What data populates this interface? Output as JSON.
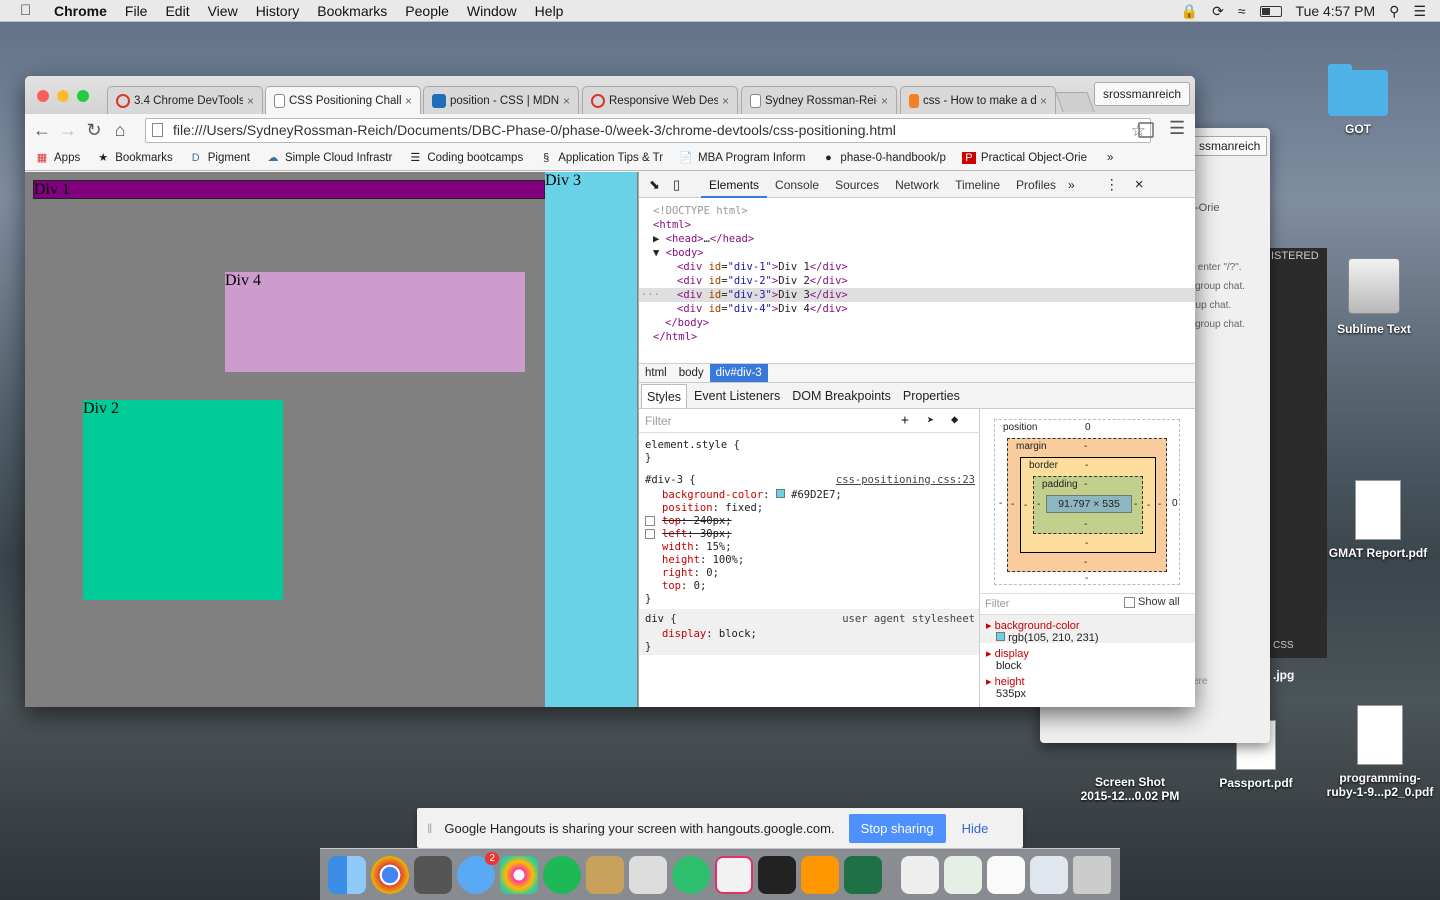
{
  "menubar": {
    "app": "Chrome",
    "items": [
      "File",
      "Edit",
      "View",
      "History",
      "Bookmarks",
      "People",
      "Window",
      "Help"
    ],
    "clock": "Tue 4:57 PM"
  },
  "desktop": {
    "icons": {
      "got": "GOT",
      "sublime": "Sublime Text",
      "gmat": "GMAT Report.pdf",
      "screenshot_line1": "Screen Shot",
      "screenshot_line2": "2015-12...0.02 PM",
      "passport": "Passport.pdf",
      "ruby_line1": "programming-",
      "ruby_line2": "ruby-1-9...p2_0.pdf"
    },
    "back_window": {
      "profile": "ssmanreich",
      "frag1": "-Orie",
      "chat1": "s enter \"/?\".",
      "chat2": "l group chat.",
      "chat3": "oup chat.",
      "chat4": "l group chat.",
      "istered": "ISTERED",
      "css": "CSS",
      "jpg": ".jpg",
      "ere": "ere"
    }
  },
  "browser": {
    "tabs": [
      {
        "label": "3.4 Chrome DevTools",
        "color": "#d9372b"
      },
      {
        "label": "CSS Positioning Challenge",
        "color": "#ffffff"
      },
      {
        "label": "position - CSS | MDN",
        "color": "#1c6fb8"
      },
      {
        "label": "Responsive Web Design",
        "color": "#d9372b"
      },
      {
        "label": "Sydney Rossman-Reich",
        "color": "#ffffff"
      },
      {
        "label": "css - How to make a div",
        "color": "#f48024"
      }
    ],
    "profile": "srossmanreich",
    "url": "file:///Users/SydneyRossman-Reich/Documents/DBC-Phase-0/phase-0/week-3/chrome-devtools/css-positioning.html",
    "bookmarks": [
      {
        "icon": "apps-icon",
        "label": "Apps"
      },
      {
        "icon": "star-icon",
        "label": "Bookmarks"
      },
      {
        "icon": "pigment-icon",
        "label": "Pigment"
      },
      {
        "icon": "cloud-icon",
        "label": "Simple Cloud Infrastr"
      },
      {
        "icon": "bars-icon",
        "label": "Coding bootcamps"
      },
      {
        "icon": "link-icon",
        "label": "Application Tips & Tr"
      },
      {
        "icon": "doc-icon",
        "label": "MBA Program Inform"
      },
      {
        "icon": "github-icon",
        "label": "phase-0-handbook/p"
      },
      {
        "icon": "p-icon",
        "label": "Practical Object-Orie"
      }
    ]
  },
  "page": {
    "div1": "Div 1",
    "div2": "Div 2",
    "div3": "Div 3",
    "div4": "Div 4"
  },
  "devtools": {
    "tabs": [
      "Elements",
      "Console",
      "Sources",
      "Network",
      "Timeline",
      "Profiles"
    ],
    "breadcrumbs": [
      "html",
      "body",
      "div#div-3"
    ],
    "style_tabs": [
      "Styles",
      "Event Listeners",
      "DOM Breakpoints",
      "Properties"
    ],
    "filter_placeholder": "Filter",
    "element_style": "element.style {",
    "rule_selector": "#div-3 {",
    "rule_source": "css-positioning.css:23",
    "bg_color_value": "#69D2E7;",
    "decls": [
      {
        "prop": "position",
        "value": "fixed;",
        "struck": false
      },
      {
        "prop": "top",
        "value": "240px;",
        "struck": true
      },
      {
        "prop": "left",
        "value": "30px;",
        "struck": true
      },
      {
        "prop": "width",
        "value": "15%;",
        "struck": false
      },
      {
        "prop": "height",
        "value": "100%;",
        "struck": false
      },
      {
        "prop": "right",
        "value": "0;",
        "struck": false
      },
      {
        "prop": "top",
        "value": "0;",
        "struck": false
      }
    ],
    "ua_selector": "div {",
    "ua_source": "user agent stylesheet",
    "ua_decl": "display: block;",
    "boxmodel": {
      "position": "position",
      "position_top": "0",
      "right_val": "0",
      "left_val": "-",
      "margin": "margin",
      "border": "border",
      "padding": "padding",
      "dash": "-",
      "size": "91.797 × 535"
    },
    "computed": {
      "filter": "Filter",
      "show_all": "Show all",
      "items": [
        {
          "name": "background-color",
          "value": "rgb(105, 210, 231)"
        },
        {
          "name": "display",
          "value": "block"
        },
        {
          "name": "height",
          "value": "535px"
        }
      ]
    }
  },
  "hangouts": {
    "message": "Google Hangouts is sharing your screen with hangouts.google.com.",
    "stop": "Stop sharing",
    "hide": "Hide"
  },
  "dock": {
    "badge": "2"
  }
}
